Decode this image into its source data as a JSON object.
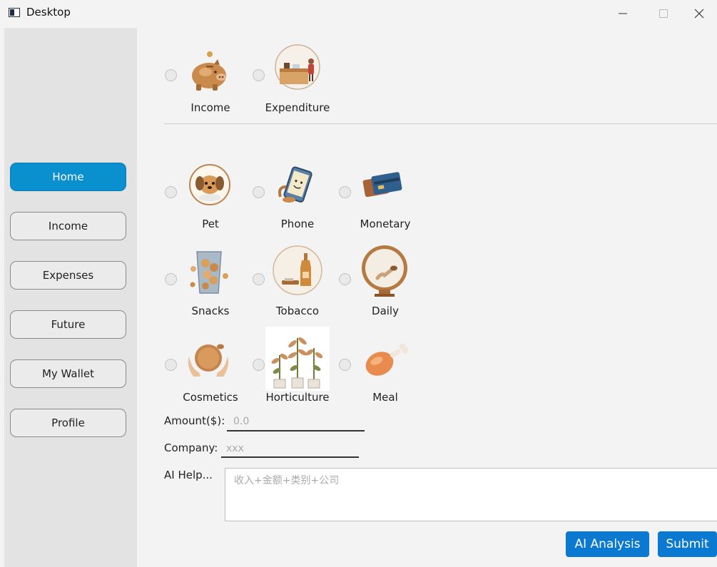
{
  "window": {
    "title": "Desktop",
    "controls": [
      "minimize-icon",
      "maximize-icon",
      "close-icon"
    ]
  },
  "sidebar": {
    "items": [
      {
        "label": "Home",
        "active": true
      },
      {
        "label": "Income"
      },
      {
        "label": "Expenses"
      },
      {
        "label": "Future"
      },
      {
        "label": "My Wallet"
      },
      {
        "label": "Profile"
      }
    ]
  },
  "type_options": [
    {
      "label": "Income",
      "icon": "piggy-bank-icon",
      "selected": false
    },
    {
      "label": "Expenditure",
      "icon": "shopping-counter-icon",
      "selected": false
    }
  ],
  "categories": [
    {
      "label": "Pet",
      "icon": "puppy-icon",
      "selected": false
    },
    {
      "label": "Phone",
      "icon": "phone-icon",
      "selected": false
    },
    {
      "label": "Monetary",
      "icon": "credit-card-icon",
      "selected": false
    },
    {
      "label": "Snacks",
      "icon": "snack-bag-icon",
      "selected": false
    },
    {
      "label": "Tobacco",
      "icon": "bottle-icon",
      "selected": false
    },
    {
      "label": "Daily",
      "icon": "mirror-icon",
      "selected": false
    },
    {
      "label": "Cosmetics",
      "icon": "compact-powder-icon",
      "selected": false
    },
    {
      "label": "Horticulture",
      "icon": "plants-icon",
      "selected": false
    },
    {
      "label": "Meal",
      "icon": "drumstick-icon",
      "selected": false
    }
  ],
  "form": {
    "amount_label": "Amount($):",
    "amount_placeholder": "0.0",
    "company_label": "Company:",
    "company_placeholder": "xxx",
    "ai_label": "AI Help...",
    "ai_placeholder": "收入+金额+类别+公司"
  },
  "actions": {
    "ai_analysis": "AI Analysis",
    "submit": "Submit"
  },
  "colors": {
    "accent": "#0a8fcf",
    "button": "#0a79cf"
  }
}
